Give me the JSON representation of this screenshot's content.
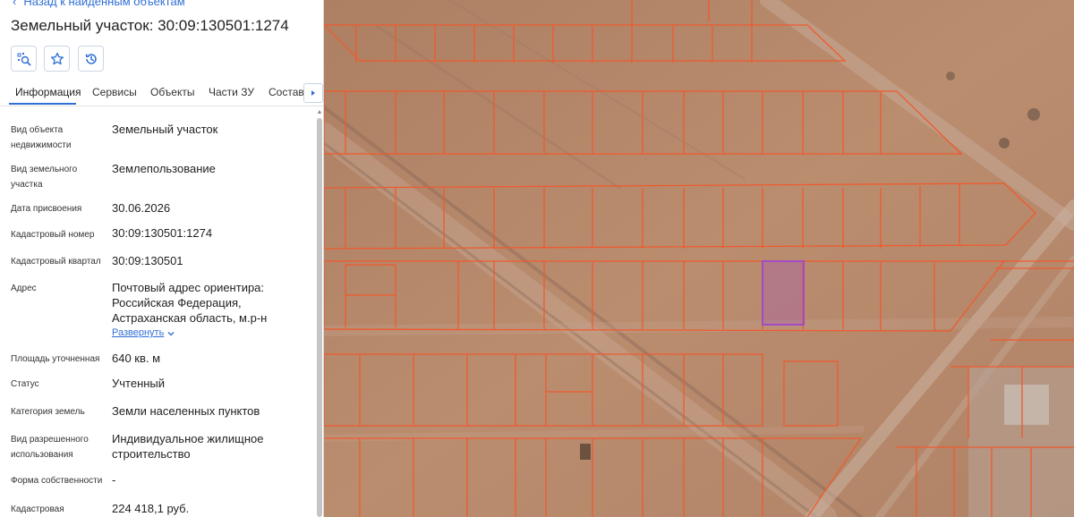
{
  "header": {
    "back_label": "Назад к найденным объектам",
    "title": "Земельный участок: 30:09:130501:1274"
  },
  "toolbar": {
    "buttons": [
      {
        "name": "locate-on-map-button",
        "icon": "locate-icon"
      },
      {
        "name": "favorite-button",
        "icon": "star-icon"
      },
      {
        "name": "history-button",
        "icon": "history-icon"
      }
    ]
  },
  "tabs": [
    {
      "label": "Информация",
      "active": true
    },
    {
      "label": "Сервисы"
    },
    {
      "label": "Объекты"
    },
    {
      "label": "Части ЗУ"
    },
    {
      "label": "Состав"
    }
  ],
  "details": {
    "object_type": {
      "label": "Вид объекта недвижимости",
      "value": "Земельный участок"
    },
    "land_type": {
      "label": "Вид земельного участка",
      "value": "Землепользование"
    },
    "assigned_date": {
      "label": "Дата присвоения",
      "value": "30.06.2026"
    },
    "cadastral_number": {
      "label": "Кадастровый номер",
      "value": "30:09:130501:1274"
    },
    "cadastral_block": {
      "label": "Кадастровый квартал",
      "value": "30:09:130501"
    },
    "address": {
      "label": "Адрес",
      "value": "Почтовый адрес ориентира: Российская Федерация, Астраханская область, м.р-н",
      "expand_label": "Развернуть"
    },
    "area": {
      "label": "Площадь уточненная",
      "value": "640 кв. м"
    },
    "status": {
      "label": "Статус",
      "value": "Учтенный"
    },
    "category": {
      "label": "Категория земель",
      "value": "Земли населенных пунктов"
    },
    "permitted_use": {
      "label": "Вид разрешенного использования",
      "value": "Индивидуальное жилищное строительство"
    },
    "ownership": {
      "label": "Форма собственности",
      "value": "-"
    },
    "cadastral_value": {
      "label": "Кадастровая",
      "value": "224 418,1 руб."
    }
  },
  "colors": {
    "accent": "#2f6fd6",
    "parcel_border": "#ef5a2e",
    "selected_parcel": "#a24bc4",
    "terrain": "#b8896b"
  }
}
